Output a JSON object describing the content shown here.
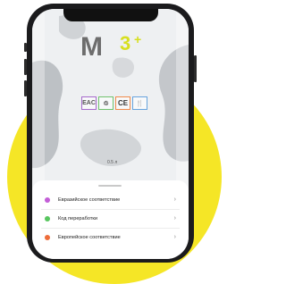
{
  "product": {
    "logo": {
      "letter": "M",
      "number": "3",
      "plus": "+"
    },
    "marks": [
      "EAC",
      "♲",
      "CE",
      "🍴"
    ],
    "volume": "0.5 л"
  },
  "sheet": {
    "items": [
      {
        "label": "Евразийское соответствие",
        "color": "#c35ed7"
      },
      {
        "label": "Код переработки",
        "color": "#58c65f"
      },
      {
        "label": "Европейское соответствие",
        "color": "#ee6d3a"
      }
    ]
  },
  "colors": {
    "background_disc": "#f5e626",
    "logo_accent": "#d7df20",
    "phone_frame": "#1b1b1d"
  },
  "icons": [
    "chevron-right-icon",
    "eac-mark-icon",
    "recycle-icon",
    "ce-mark-icon",
    "food-safe-icon"
  ]
}
